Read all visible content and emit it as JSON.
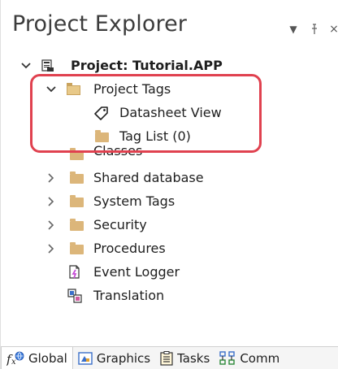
{
  "window": {
    "title": "Project Explorer",
    "controls": {
      "dropdown_glyph": "▼",
      "pin_glyph": "⊥",
      "close_glyph": "×"
    }
  },
  "tree": {
    "root": {
      "label": "Project: Tutorial.APP",
      "icon": "project-icon",
      "expanded": true
    },
    "project_tags": {
      "label": "Project Tags",
      "icon": "folder-open-icon",
      "expanded": true
    },
    "datasheet_view": {
      "label": "Datasheet View",
      "icon": "tag-icon"
    },
    "tag_list": {
      "label": "Tag List (0)",
      "icon": "folder-icon"
    },
    "classes": {
      "label": "Classes",
      "icon": "folder-icon"
    },
    "shared_database": {
      "label": "Shared database",
      "icon": "folder-icon",
      "expanded": false
    },
    "system_tags": {
      "label": "System Tags",
      "icon": "folder-icon",
      "expanded": false
    },
    "security": {
      "label": "Security",
      "icon": "folder-icon",
      "expanded": false
    },
    "procedures": {
      "label": "Procedures",
      "icon": "folder-icon",
      "expanded": false
    },
    "event_logger": {
      "label": "Event Logger",
      "icon": "event-logger-icon"
    },
    "translation": {
      "label": "Translation",
      "icon": "translation-icon"
    }
  },
  "highlight": {
    "color": "#e0414f"
  },
  "tabs": [
    {
      "label": "Global",
      "icon": "fx-globe-icon",
      "active": true
    },
    {
      "label": "Graphics",
      "icon": "graphics-icon",
      "active": false
    },
    {
      "label": "Tasks",
      "icon": "tasks-icon",
      "active": false
    },
    {
      "label": "Comm",
      "icon": "comm-icon",
      "active": false
    }
  ],
  "colors": {
    "folder": "#dcb67a",
    "title_text": "#3c3c3c",
    "highlight": "#e0414f"
  }
}
